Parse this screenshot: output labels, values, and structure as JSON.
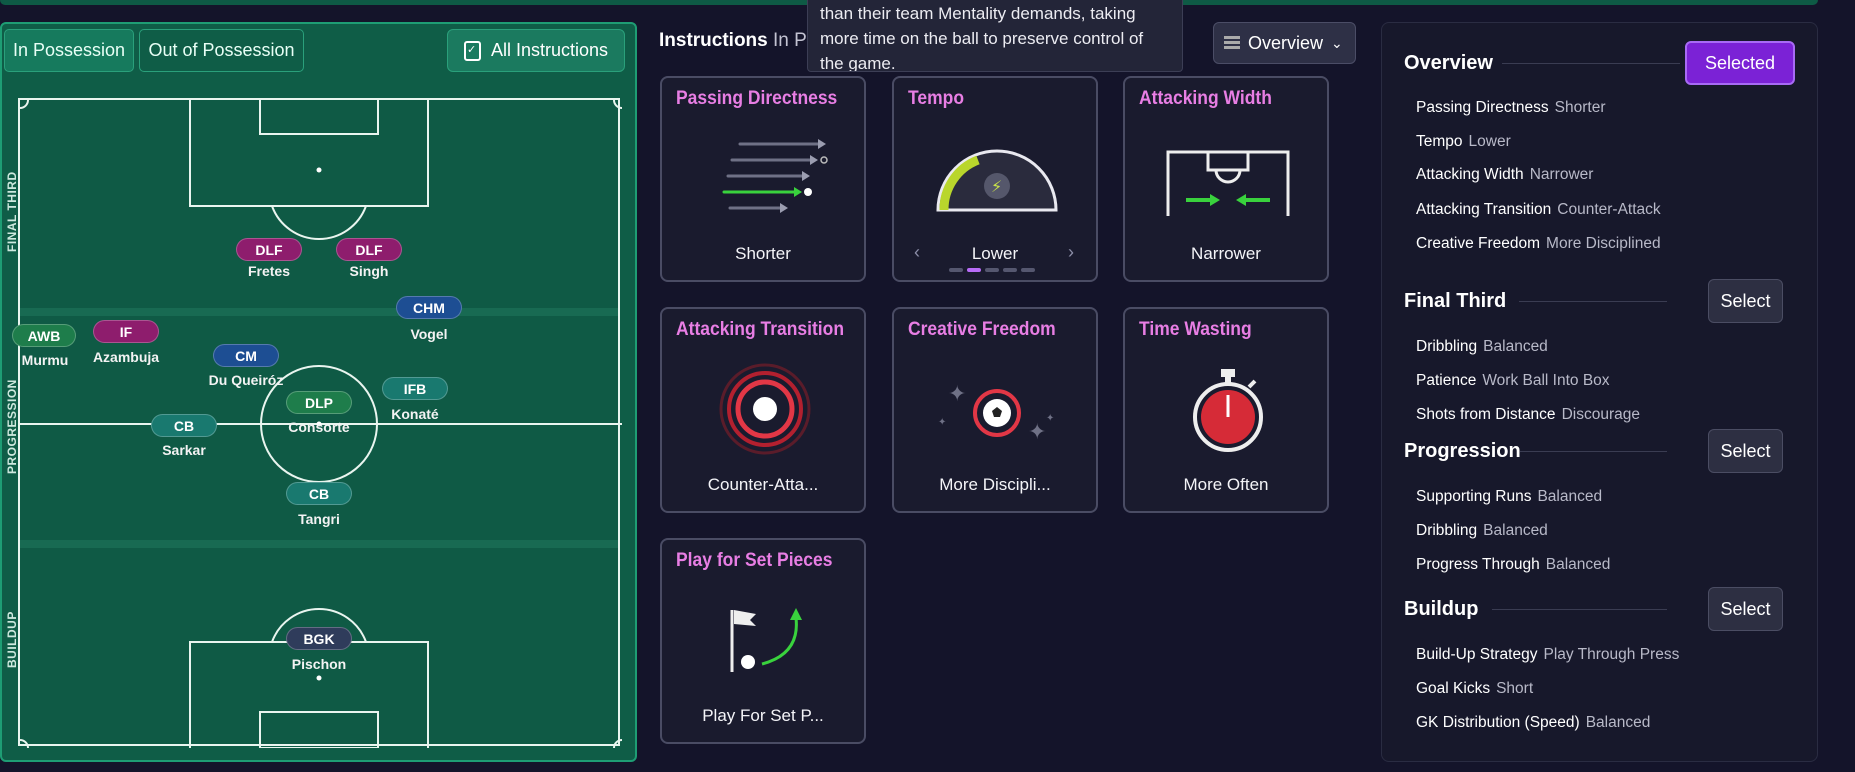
{
  "tabs": {
    "in_possession": "In Possession",
    "out_of_possession": "Out of Possession",
    "all_instructions": "All Instructions"
  },
  "zones": {
    "final_third": "FINAL THIRD",
    "progression": "PROGRESSION",
    "buildup": "BUILDUP"
  },
  "players": [
    {
      "role": "DLF",
      "name": "Fretes"
    },
    {
      "role": "DLF",
      "name": "Singh"
    },
    {
      "role": "CHM",
      "name": "Vogel"
    },
    {
      "role": "AWB",
      "name": "Murmu"
    },
    {
      "role": "IF",
      "name": "Azambuja"
    },
    {
      "role": "CM",
      "name": "Du Queiróz"
    },
    {
      "role": "DLP",
      "name": "Consorte"
    },
    {
      "role": "IFB",
      "name": "Konaté"
    },
    {
      "role": "CB",
      "name": "Sarkar"
    },
    {
      "role": "CB",
      "name": "Tangri"
    },
    {
      "role": "BGK",
      "name": "Pischon"
    }
  ],
  "center": {
    "title": "Instructions",
    "subtitle": "In P",
    "tooltip": "than their team Mentality demands, taking more time on the ball to preserve control of the game.",
    "dropdown": "Overview",
    "cards": [
      {
        "title": "Passing Directness",
        "value": "Shorter"
      },
      {
        "title": "Tempo",
        "value": "Lower"
      },
      {
        "title": "Attacking Width",
        "value": "Narrower"
      },
      {
        "title": "Attacking Transition",
        "value": "Counter-Atta..."
      },
      {
        "title": "Creative Freedom",
        "value": "More Discipli..."
      },
      {
        "title": "Time Wasting",
        "value": "More Often"
      },
      {
        "title": "Play for Set Pieces",
        "value": "Play For Set P..."
      }
    ]
  },
  "right": {
    "overview": {
      "title": "Overview",
      "button": "Selected",
      "rows": [
        {
          "k": "Passing Directness",
          "v": "Shorter"
        },
        {
          "k": "Tempo",
          "v": "Lower"
        },
        {
          "k": "Attacking Width",
          "v": "Narrower"
        },
        {
          "k": "Attacking Transition",
          "v": "Counter-Attack"
        },
        {
          "k": "Creative Freedom",
          "v": "More Disciplined"
        }
      ]
    },
    "final_third": {
      "title": "Final Third",
      "button": "Select",
      "rows": [
        {
          "k": "Dribbling",
          "v": "Balanced"
        },
        {
          "k": "Patience",
          "v": "Work Ball Into Box"
        },
        {
          "k": "Shots from Distance",
          "v": "Discourage"
        }
      ]
    },
    "progression": {
      "title": "Progression",
      "button": "Select",
      "rows": [
        {
          "k": "Supporting Runs",
          "v": "Balanced"
        },
        {
          "k": "Dribbling",
          "v": "Balanced"
        },
        {
          "k": "Progress Through",
          "v": "Balanced"
        }
      ]
    },
    "buildup": {
      "title": "Buildup",
      "button": "Select",
      "rows": [
        {
          "k": "Build-Up Strategy",
          "v": "Play Through Press"
        },
        {
          "k": "Goal Kicks",
          "v": "Short"
        },
        {
          "k": "GK Distribution (Speed)",
          "v": "Balanced"
        }
      ]
    }
  }
}
